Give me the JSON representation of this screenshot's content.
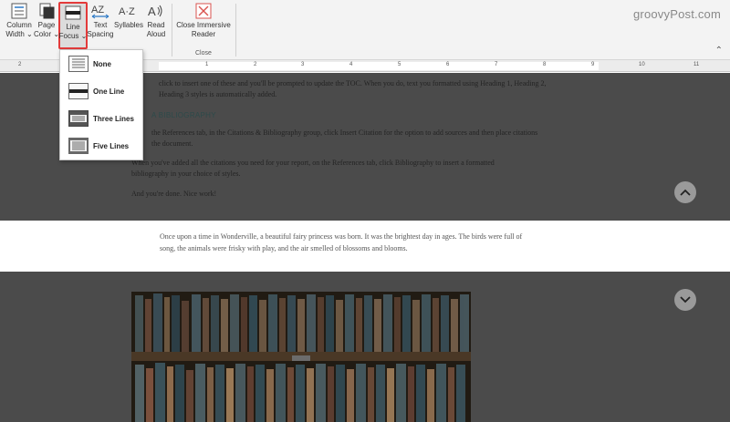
{
  "ribbon": {
    "column_width": {
      "line1": "Column",
      "line2": "Width ⌄"
    },
    "page_color": {
      "line1": "Page",
      "line2": "Color ⌄"
    },
    "line_focus": {
      "line1": "Line",
      "line2": "Focus ⌄"
    },
    "text_spacing": {
      "line1": "Text",
      "line2": "Spacing"
    },
    "syllables": {
      "line1": "Syllables"
    },
    "read_aloud": {
      "line1": "Read",
      "line2": "Aloud"
    },
    "close_reader": {
      "line1": "Close Immersive",
      "line2": "Reader"
    },
    "close_group_label": "Close",
    "brand": "groovyPost.com",
    "accent_color": "#e33a3a"
  },
  "ruler": {
    "numbers": [
      "2",
      "1",
      "1",
      "2",
      "3",
      "4",
      "5",
      "6",
      "7",
      "8",
      "9",
      "10",
      "11"
    ]
  },
  "line_focus_menu": {
    "none": "None",
    "one": "One Line",
    "three": "Three Lines",
    "five": "Five Lines",
    "selected": "Three Lines"
  },
  "doc": {
    "dim_line1": "click to insert one of these and you'll be prompted to update the TOC. When you do, text you formatted using Heading 1, Heading 2,",
    "dim_line2": "Heading 3 styles is automatically added.",
    "heading": "A BIBLIOGRAPHY",
    "dim_line3": "the References tab, in the Citations & Bibliography group, click Insert Citation for the option to add sources and then place citations",
    "dim_line4": "the document.",
    "dim_line5": "When you've added all the citations you need for your report, on the References tab, click Bibliography to insert a formatted",
    "dim_line6": "bibliography in your choice of styles.",
    "dim_line7": "And you're done. Nice work!",
    "focus_line1": "Once upon a time in Wonderville, a beautiful fairy princess was born. It was the brightest day in ages. The birds were full of",
    "focus_line2": "song, the animals were frisky with play, and the air smelled of blossoms and blooms."
  }
}
